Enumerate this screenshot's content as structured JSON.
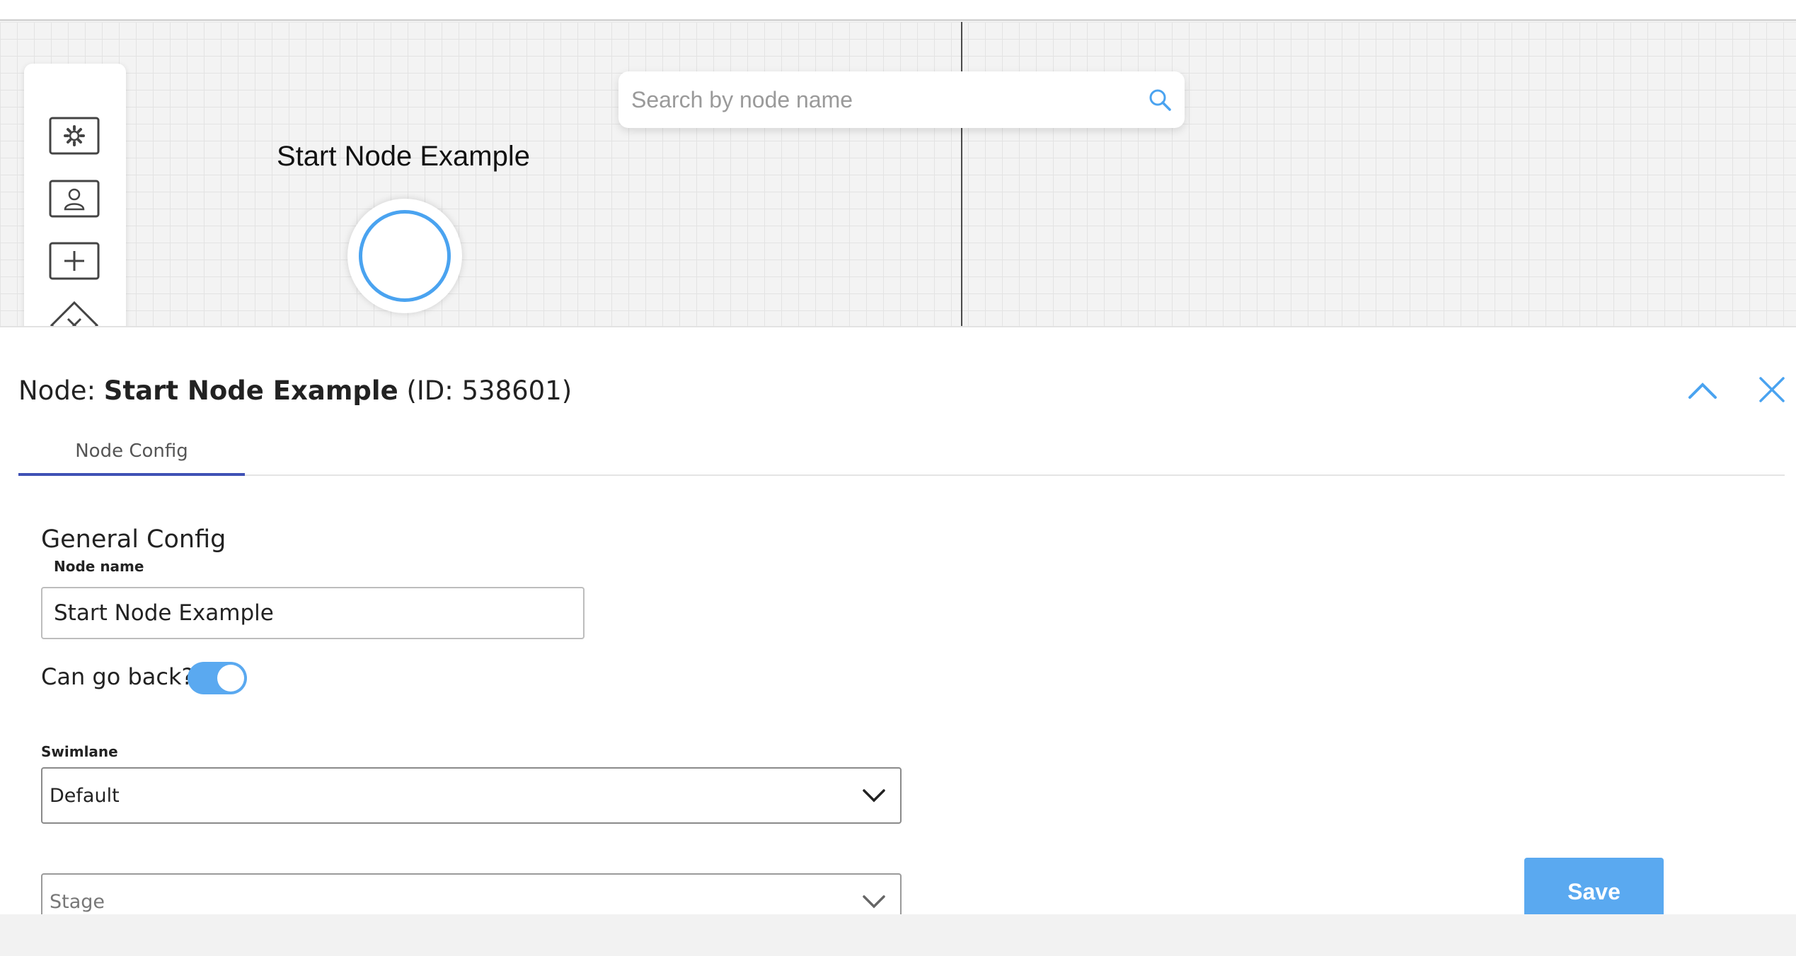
{
  "search": {
    "placeholder": "Search by node name"
  },
  "canvas": {
    "node_label": "Start Node Example"
  },
  "toolbox": {
    "tools": [
      {
        "icon": "gear-icon"
      },
      {
        "icon": "user-icon"
      },
      {
        "icon": "plus-icon"
      },
      {
        "icon": "exclusive-gateway-icon"
      }
    ]
  },
  "panel": {
    "title_prefix": "Node: ",
    "title_name": "Start Node Example",
    "title_suffix": " (ID: 538601)",
    "tabs": [
      {
        "label": "Node Config"
      }
    ],
    "section_title": "General Config",
    "node_name_label": "Node name",
    "node_name_value": "Start Node Example",
    "can_go_back_label": "Can go back?",
    "can_go_back": true,
    "swimlane_label": "Swimlane",
    "swimlane_value": "Default",
    "stage_placeholder": "Stage",
    "save_label": "Save"
  },
  "colors": {
    "accent": "#5aa9f0",
    "tab_indicator": "#3f51b5",
    "node_border": "#4aa3f0"
  }
}
